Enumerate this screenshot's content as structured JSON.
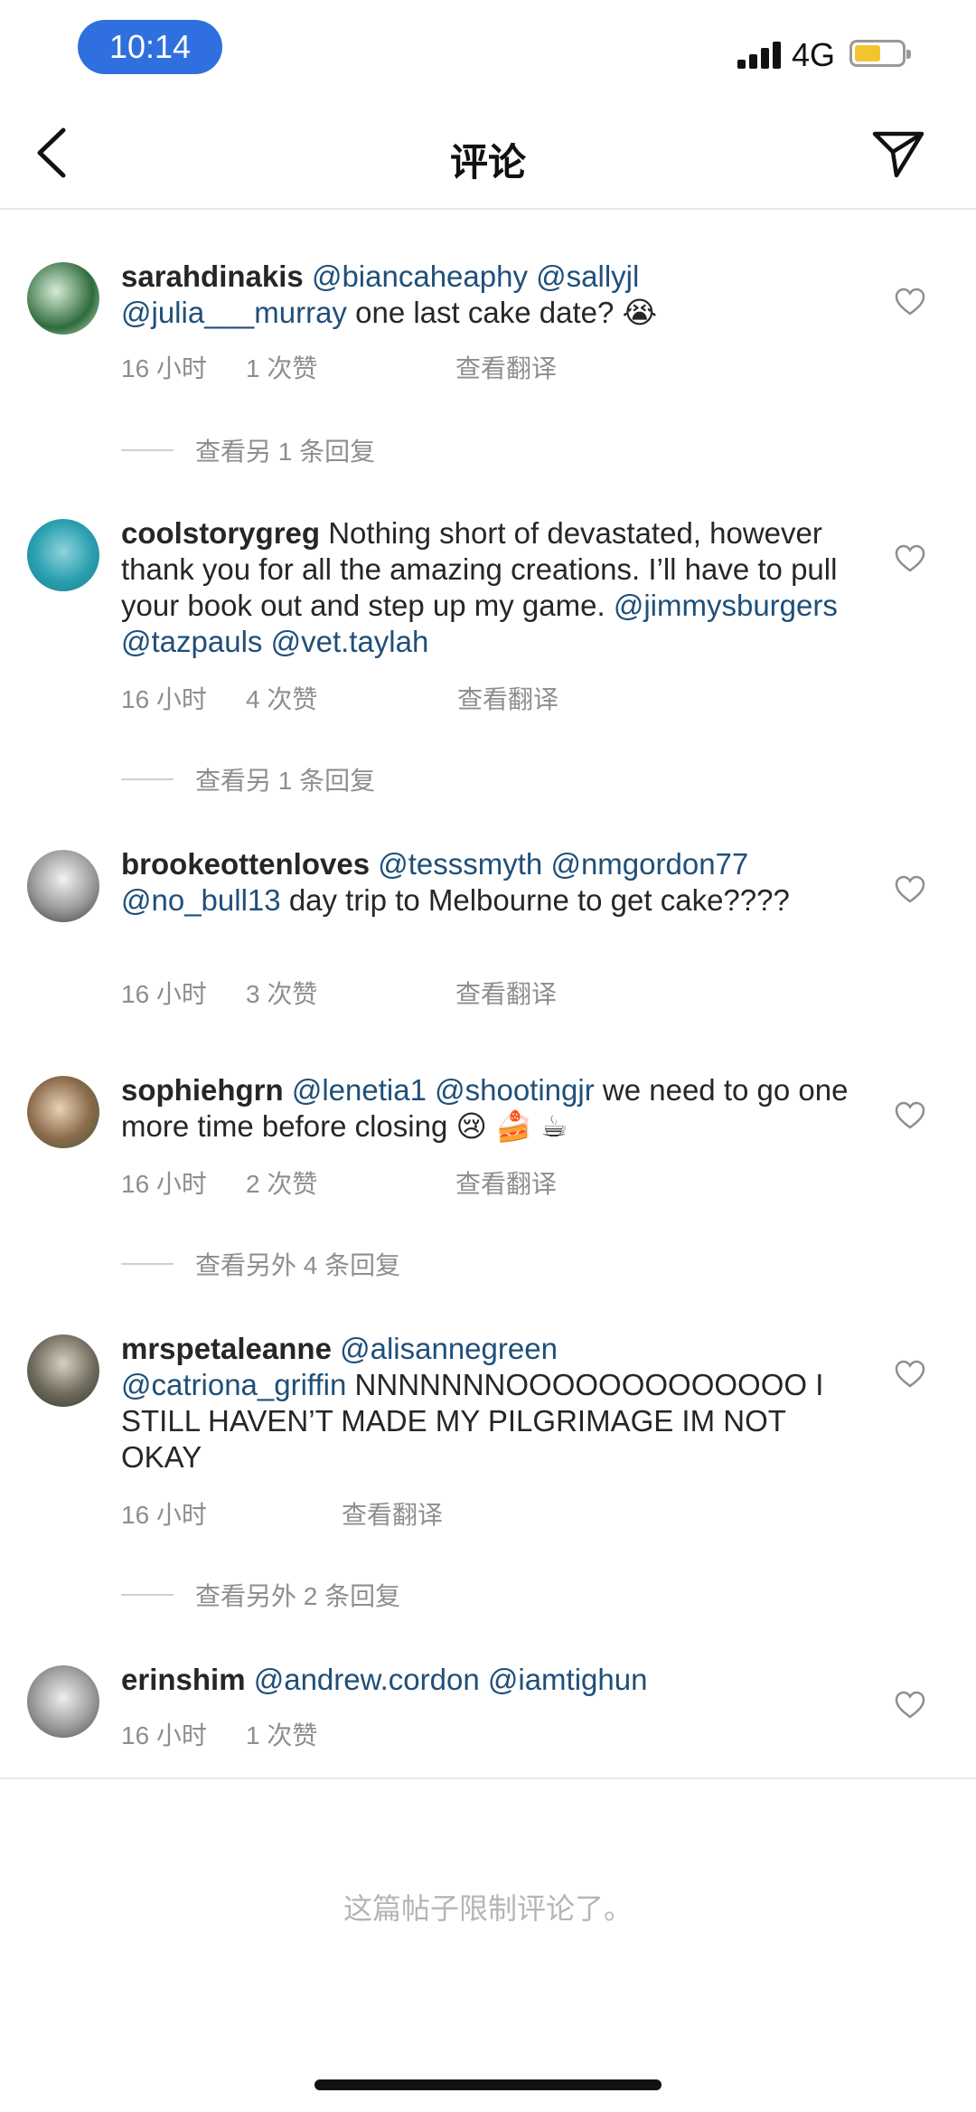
{
  "status_bar": {
    "time": "10:14",
    "network": "4G",
    "battery_color": "#f4c430"
  },
  "nav": {
    "title": "评论",
    "back_icon": "chevron-left-icon",
    "share_icon": "paper-plane-icon"
  },
  "comments": [
    {
      "username": "sarahdinakis",
      "mentions": [
        "@biancaheaphy",
        "@sallyjl",
        "@julia___murray"
      ],
      "text": "one last cake date? 😭",
      "time": "16 小时",
      "likes": "1 次赞",
      "translate": "查看翻译",
      "replies": "查看另 1 条回复"
    },
    {
      "username": "coolstorygreg",
      "text": "Nothing short of devastated, however thank you for all the amazing creations. I’ll have to pull your book out and step up my game.",
      "mentions": [
        "@jimmysburgers",
        "@tazpauls",
        "@vet.taylah"
      ],
      "time": "16 小时",
      "likes": "4 次赞",
      "translate": "查看翻译",
      "replies": "查看另 1 条回复"
    },
    {
      "username": "brookeottenloves",
      "mentions": [
        "@tesssmyth",
        "@nmgordon77",
        "@no_bull13"
      ],
      "text": "day trip to Melbourne to get cake????",
      "time": "16 小时",
      "likes": "3 次赞",
      "translate": "查看翻译"
    },
    {
      "username": "sophiehgrn",
      "mentions": [
        "@lenetia1",
        "@shootingjr"
      ],
      "text": "we need to go one more time before closing 😢 🍰 ☕",
      "time": "16 小时",
      "likes": "2 次赞",
      "translate": "查看翻译",
      "replies": "查看另外 4 条回复"
    },
    {
      "username": "mrspetaleanne",
      "mentions": [
        "@alisannegreen",
        "@catriona_griffin"
      ],
      "text": "NNNNNNNOOOOOOOOOOOOO I STILL HAVEN’T MADE MY PILGRIMAGE IM NOT OKAY",
      "time": "16 小时",
      "translate": "查看翻译",
      "replies": "查看另外 2 条回复"
    },
    {
      "username": "erinshim",
      "mentions": [
        "@andrew.cordon",
        "@iamtighun"
      ],
      "time": "16 小时",
      "likes": "1 次赞"
    }
  ],
  "footer": {
    "restricted_text": "这篇帖子限制评论了。"
  },
  "colors": {
    "mention": "#1f4f7a",
    "meta": "#8e8e8e",
    "accent": "#2f6fe0"
  }
}
